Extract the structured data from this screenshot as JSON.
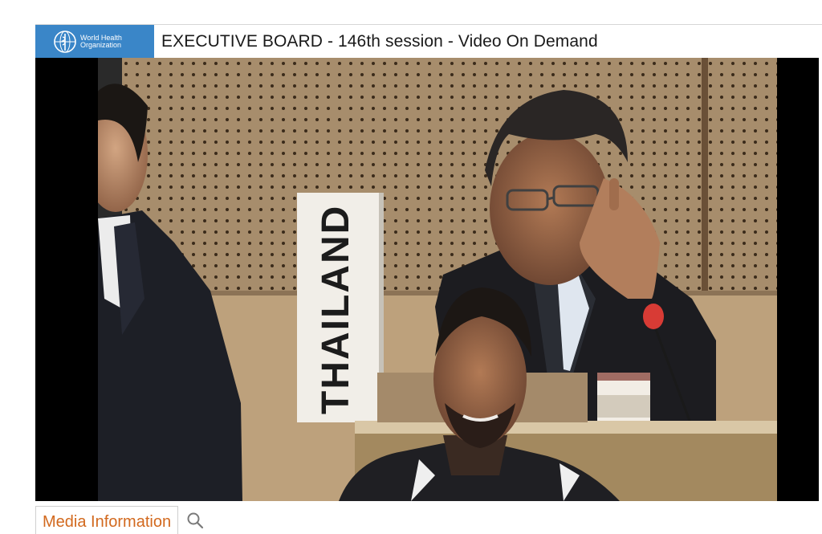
{
  "header": {
    "logo_text": "World Health\nOrganization",
    "title": "EXECUTIVE BOARD - 146th session - Video On Demand"
  },
  "video": {
    "nameplate": "THAILAND"
  },
  "tabs": [
    {
      "label": "Media Information",
      "active": true
    }
  ],
  "icons": {
    "logo": "who-emblem-icon",
    "search": "search-icon"
  },
  "colors": {
    "header_blue": "#3a86c8",
    "tab_label": "#d2691e"
  }
}
